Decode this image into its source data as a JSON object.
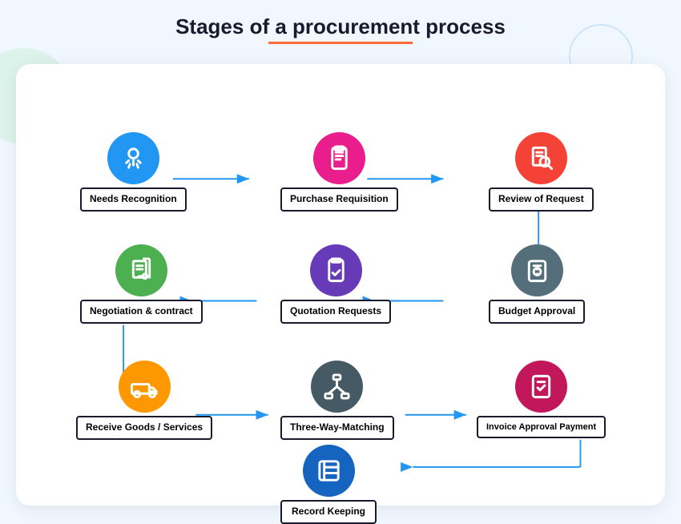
{
  "page": {
    "title": "Stages of a procurement process",
    "background_color": "#f0f7ff"
  },
  "nodes": [
    {
      "id": "needs",
      "label": "Needs Recognition",
      "circle_class": "circle-blue",
      "icon": "award"
    },
    {
      "id": "purchase",
      "label": "Purchase Requisition",
      "circle_class": "circle-pink",
      "icon": "clipboard-list"
    },
    {
      "id": "review",
      "label": "Review of Request",
      "circle_class": "circle-red",
      "icon": "search-doc"
    },
    {
      "id": "negotiation",
      "label": "Negotiation & contract",
      "circle_class": "circle-green",
      "icon": "doc-money"
    },
    {
      "id": "quotation",
      "label": "Quotation Requests",
      "circle_class": "circle-purple",
      "icon": "clipboard-check"
    },
    {
      "id": "budget",
      "label": "Budget Approval",
      "circle_class": "circle-dark",
      "icon": "dollar-doc"
    },
    {
      "id": "receive",
      "label": "Receive Goods / Services",
      "circle_class": "circle-orange",
      "icon": "truck"
    },
    {
      "id": "matching",
      "label": "Three-Way-Matching",
      "circle_class": "circle-gray-dark",
      "icon": "network"
    },
    {
      "id": "invoice",
      "label": "Invoice Approval Payment",
      "circle_class": "circle-magenta",
      "icon": "doc-check"
    },
    {
      "id": "record",
      "label": "Record Keeping",
      "circle_class": "circle-dark-blue",
      "icon": "archive"
    }
  ]
}
